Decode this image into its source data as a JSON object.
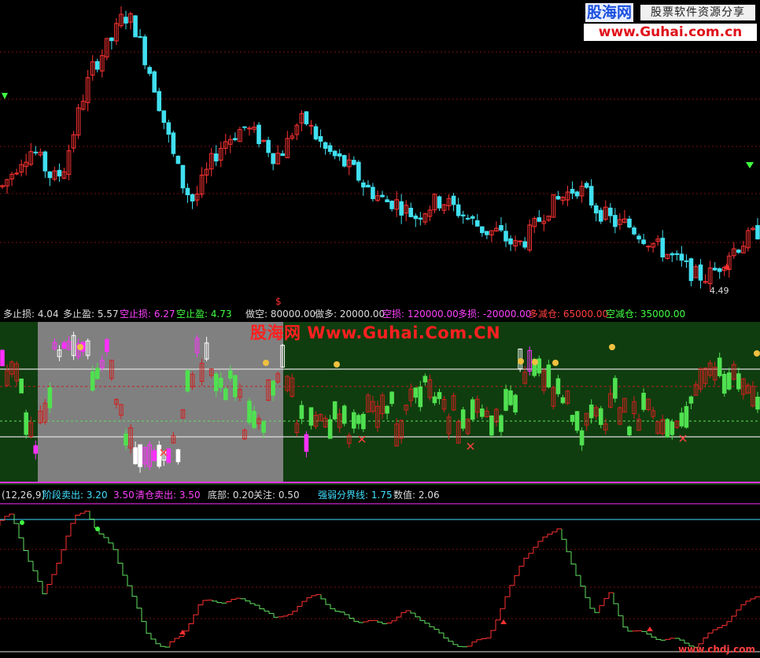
{
  "logo": {
    "brand": "股海网",
    "tagline": "股票软件资源分享",
    "url": "www.Guhai.com.cn"
  },
  "watermark": {
    "cn": "股海网",
    "url": "Www.Guhai.Com.CN"
  },
  "corner_mark": "www.chdj.com",
  "main_pane": {
    "low_label": "4.49",
    "dollar_marker": "$"
  },
  "info_bar_1": {
    "items": [
      {
        "label": "多止损:",
        "value": "4.04",
        "color": "#dddddd"
      },
      {
        "label": "多止盈:",
        "value": "5.57",
        "color": "#dddddd"
      },
      {
        "label": "空止损:",
        "value": "6.27",
        "color": "#ff40ff"
      },
      {
        "label": "空止盈:",
        "value": "4.73",
        "color": "#40ff40"
      },
      {
        "label": "做空:",
        "value": "80000.00",
        "color": "#dddddd"
      },
      {
        "label": "做多:",
        "value": "20000.00",
        "color": "#dddddd"
      },
      {
        "label": "空损:",
        "value": "120000.00",
        "color": "#ff40ff"
      },
      {
        "label": "多损:",
        "value": "-20000.00",
        "color": "#ff40ff"
      },
      {
        "label": "多减仓:",
        "value": "65000.00",
        "color": "#ff4040"
      },
      {
        "label": "空减仓:",
        "value": "35000.00",
        "color": "#40ff40"
      }
    ]
  },
  "info_bar_2": {
    "params": "(12,26,9)",
    "items": [
      {
        "label": "阶段卖出:",
        "value": "3.20",
        "color": "#40e0ff"
      },
      {
        "label": "",
        "value": "3.50",
        "color": "#ff40ff"
      },
      {
        "label": "清仓卖出:",
        "value": "3.50",
        "color": "#ff40ff"
      },
      {
        "label": "底部:",
        "value": "0.20",
        "color": "#dddddd"
      },
      {
        "label": "关注:",
        "value": "0.50",
        "color": "#dddddd"
      },
      {
        "label": "强弱分界线:",
        "value": "1.75",
        "color": "#40e0ff"
      },
      {
        "label": "数值:",
        "value": "2.06",
        "color": "#dddddd"
      }
    ]
  },
  "colors": {
    "up": "#ff3333",
    "down": "#40e0f0",
    "sub_bg": "#0f3d0f",
    "highlight_bg": "#808080",
    "magenta": "#ff30ff"
  },
  "chart_data": {
    "type": "candlestick",
    "main_series_trend": [
      5.1,
      5.2,
      5.3,
      5.35,
      5.25,
      5.15,
      5.2,
      5.45,
      5.7,
      5.9,
      6.0,
      6.1,
      6.25,
      6.2,
      6.0,
      5.8,
      5.55,
      5.3,
      5.1,
      5.0,
      5.15,
      5.3,
      5.4,
      5.45,
      5.5,
      5.45,
      5.4,
      5.3,
      5.35,
      5.5,
      5.55,
      5.45,
      5.35,
      5.3,
      5.25,
      5.2,
      5.1,
      5.05,
      5.0,
      5.0,
      4.95,
      4.9,
      4.95,
      5.0,
      5.0,
      4.95,
      4.9,
      4.85,
      4.8,
      4.8,
      4.75,
      4.7,
      4.75,
      4.85,
      4.95,
      5.0,
      5.05,
      5.1,
      5.05,
      4.95,
      4.9,
      4.85,
      4.85,
      4.8,
      4.75,
      4.7,
      4.65,
      4.6,
      4.55,
      4.5,
      4.5,
      4.55,
      4.65,
      4.7,
      4.75,
      4.8
    ]
  }
}
